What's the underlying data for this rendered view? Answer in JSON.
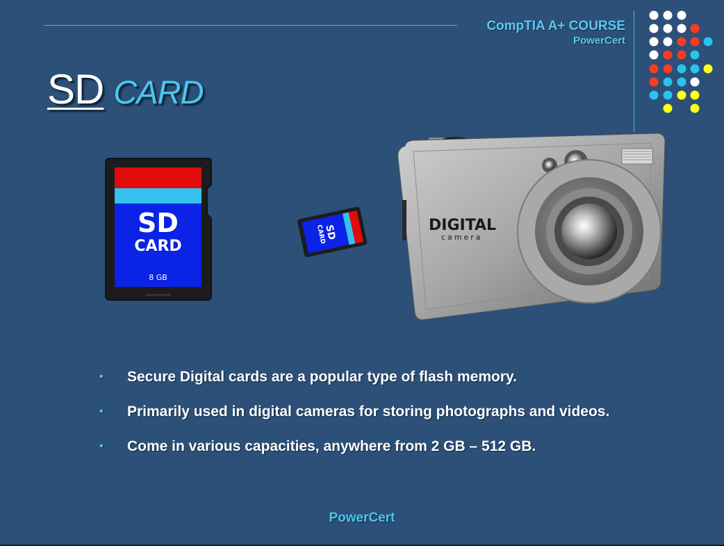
{
  "header": {
    "course": "CompTIA A+ COURSE",
    "brand": "PowerCert"
  },
  "title": {
    "main": "SD",
    "sub": "CARD"
  },
  "sd_card_large": {
    "line1": "SD",
    "line2": "CARD",
    "capacity": "8 GB"
  },
  "sd_card_small": {
    "line1": "SD",
    "line2": "CARD"
  },
  "camera": {
    "brand": "DIGITAL",
    "sub": "camera"
  },
  "bullets": [
    "Secure Digital cards are a popular type of flash memory.",
    "Primarily used in digital cameras for storing photographs and videos.",
    "Come in various capacities, anywhere from 2 GB – 512 GB."
  ],
  "bullet_glyph": "•",
  "footer": {
    "brand": "PowerCert"
  },
  "colors": {
    "background": "#2c5078",
    "accent": "#4cc6ee",
    "dot_white": "#ffffff",
    "dot_red": "#ff3b1f",
    "dot_cyan": "#29c3ef",
    "dot_yellow": "#ffff19",
    "card_red": "#e10b0b",
    "card_blue": "#0a23e6"
  }
}
